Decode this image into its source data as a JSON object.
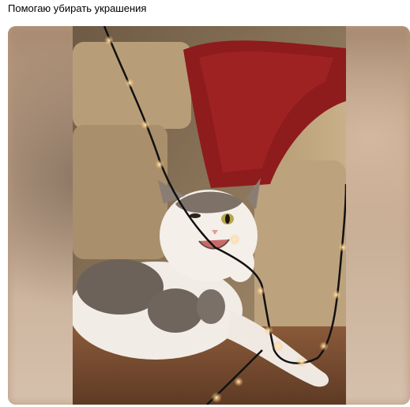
{
  "post": {
    "caption": "Помогаю убирать украшения"
  },
  "image": {
    "subject": "cat-biting-string-lights-icon"
  }
}
